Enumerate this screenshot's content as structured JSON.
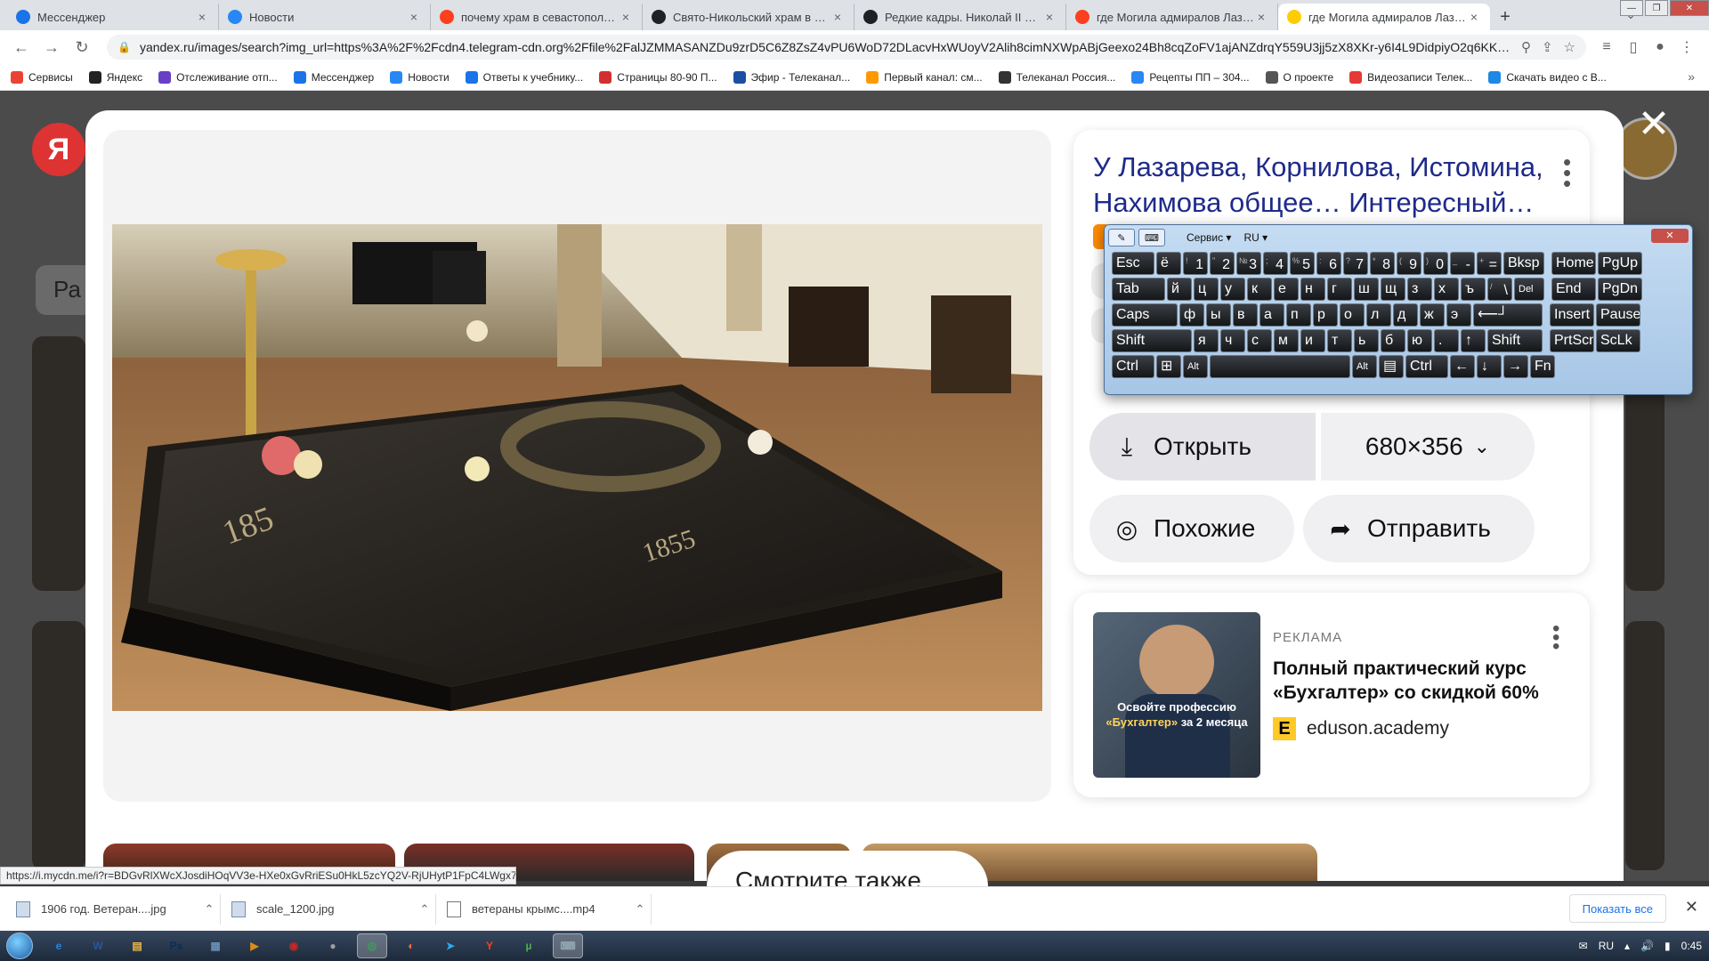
{
  "tabs": [
    {
      "title": "Мессенджер",
      "icon": "messenger-icon",
      "color": "#1a73e8",
      "active": false
    },
    {
      "title": "Новости",
      "icon": "vk-icon",
      "color": "#2787f5",
      "active": false
    },
    {
      "title": "почему храм в севастополе в ч",
      "icon": "yandex-icon",
      "color": "#fc3f1d",
      "active": false
    },
    {
      "title": "Свято-Никольский храм в Сева",
      "icon": "globe-icon",
      "color": "#202124",
      "active": false
    },
    {
      "title": "Редкие кадры. Николай II и Ром",
      "icon": "globe-icon",
      "color": "#202124",
      "active": false
    },
    {
      "title": "где Могила адмиралов Лазарев",
      "icon": "yandex-icon",
      "color": "#fc3f1d",
      "active": false
    },
    {
      "title": "где Могила адмиралов Лазарев",
      "icon": "yandex-images-icon",
      "color": "#ffcc00",
      "active": true
    }
  ],
  "address": {
    "url": "yandex.ru/images/search?img_url=https%3A%2F%2Fcdn4.telegram-cdn.org%2Ffile%2FalJZMMASANZDu9zrD5C6Z8ZsZ4vPU6WoD72DLacvHxWUoyV2Alih8cimNXWpABjGeexo24Bh8cqZoFV1ajANZdrqY559U3jj5zX8XKr-y6I4L9DidpiyO2q6KKUzYwST..."
  },
  "bookmarks": [
    {
      "label": "Сервисы",
      "color": "#ea4335"
    },
    {
      "label": "Яндекс",
      "color": "#222222"
    },
    {
      "label": "Отслеживание отп...",
      "color": "#6a3fc8"
    },
    {
      "label": "Мессенджер",
      "color": "#1a73e8"
    },
    {
      "label": "Новости",
      "color": "#2787f5"
    },
    {
      "label": "Ответы к учебнику...",
      "color": "#1a73e8"
    },
    {
      "label": "Страницы 80-90 П...",
      "color": "#d32f2f"
    },
    {
      "label": "Эфир - Телеканал...",
      "color": "#1a4fa3"
    },
    {
      "label": "Первый канал: см...",
      "color": "#ff9800"
    },
    {
      "label": "Телеканал Россия...",
      "color": "#333333"
    },
    {
      "label": "Рецепты ПП – 304...",
      "color": "#2787f5"
    },
    {
      "label": "О проекте",
      "color": "#555555"
    },
    {
      "label": "Видеозаписи Телек...",
      "color": "#e53935"
    },
    {
      "label": "Скачать видео с В...",
      "color": "#1e88e5"
    }
  ],
  "page_bg": {
    "chip_label": "Ра"
  },
  "viewer": {
    "title": "У Лазарева, Корнилова, Истомина, Нахимова общее… Интересный…",
    "open_label": "Открыть",
    "size_label": "680×356",
    "similar_label": "Похожие",
    "send_label": "Отправить",
    "tomb_year_left": "185",
    "tomb_year_right": "1855"
  },
  "ad": {
    "label": "РЕКЛАМА",
    "title": "Полный практический курс «Бухгалтер» со скидкой 60%",
    "domain": "eduson.academy",
    "image_caption_1": "Освойте профессию",
    "image_caption_2": "«Бухгалтер»",
    "image_caption_3": "за 2 месяца"
  },
  "see_also": "Смотрите также",
  "status_link": "https://i.mycdn.me/i?r=BDGvRlXWcXJosdiHOqVV3e-HXe0xGvRriESu0HkL5zcYQ2V-RjUHytP1FpC4LWgx7Mg",
  "osk": {
    "service": "Сервис",
    "lang": "RU",
    "rows": [
      [
        {
          "m": "Esc",
          "w": 48
        },
        {
          "m": "ё",
          "w": 28
        },
        {
          "m": "1",
          "s": "!",
          "w": 28
        },
        {
          "m": "2",
          "s": "\"",
          "w": 28
        },
        {
          "m": "3",
          "s": "№",
          "w": 28
        },
        {
          "m": "4",
          "s": ";",
          "w": 28
        },
        {
          "m": "5",
          "s": "%",
          "w": 28
        },
        {
          "m": "6",
          "s": ":",
          "w": 28
        },
        {
          "m": "7",
          "s": "?",
          "w": 28
        },
        {
          "m": "8",
          "s": "*",
          "w": 28
        },
        {
          "m": "9",
          "s": "(",
          "w": 28
        },
        {
          "m": "0",
          "s": ")",
          "w": 28
        },
        {
          "m": "-",
          "s": "_",
          "w": 28
        },
        {
          "m": "=",
          "s": "+",
          "w": 28
        },
        {
          "m": "Bksp",
          "w": 46
        },
        {
          "m": "Home",
          "w": 50,
          "gap": 6
        },
        {
          "m": "PgUp",
          "w": 50
        }
      ],
      [
        {
          "m": "Tab",
          "w": 60
        },
        {
          "m": "й",
          "w": 28
        },
        {
          "m": "ц",
          "w": 28
        },
        {
          "m": "у",
          "w": 28
        },
        {
          "m": "к",
          "w": 28
        },
        {
          "m": "е",
          "w": 28
        },
        {
          "m": "н",
          "w": 28
        },
        {
          "m": "г",
          "w": 28
        },
        {
          "m": "ш",
          "w": 28
        },
        {
          "m": "щ",
          "w": 28
        },
        {
          "m": "з",
          "w": 28
        },
        {
          "m": "х",
          "w": 28
        },
        {
          "m": "ъ",
          "w": 28
        },
        {
          "m": "\\",
          "s": "/",
          "w": 28
        },
        {
          "m": "Del",
          "w": 34,
          "small": true
        },
        {
          "m": "End",
          "w": 50,
          "gap": 6
        },
        {
          "m": "PgDn",
          "w": 50
        }
      ],
      [
        {
          "m": "Caps",
          "w": 74
        },
        {
          "m": "ф",
          "w": 28
        },
        {
          "m": "ы",
          "w": 28
        },
        {
          "m": "в",
          "w": 28
        },
        {
          "m": "а",
          "w": 28
        },
        {
          "m": "п",
          "w": 28
        },
        {
          "m": "р",
          "w": 28
        },
        {
          "m": "о",
          "w": 28
        },
        {
          "m": "л",
          "w": 28
        },
        {
          "m": "д",
          "w": 28
        },
        {
          "m": "ж",
          "w": 28
        },
        {
          "m": "э",
          "w": 28
        },
        {
          "m": "⟵┘",
          "w": 78
        },
        {
          "m": "Insert",
          "w": 50,
          "gap": 6
        },
        {
          "m": "Pause",
          "w": 50
        }
      ],
      [
        {
          "m": "Shift",
          "w": 90
        },
        {
          "m": "я",
          "w": 28
        },
        {
          "m": "ч",
          "w": 28
        },
        {
          "m": "с",
          "w": 28
        },
        {
          "m": "м",
          "w": 28
        },
        {
          "m": "и",
          "w": 28
        },
        {
          "m": "т",
          "w": 28
        },
        {
          "m": "ь",
          "w": 28
        },
        {
          "m": "б",
          "w": 28
        },
        {
          "m": "ю",
          "w": 28
        },
        {
          "m": ".",
          "w": 28
        },
        {
          "m": "↑",
          "w": 28
        },
        {
          "m": "Shift",
          "w": 62
        },
        {
          "m": "PrtScn",
          "w": 50,
          "gap": 6
        },
        {
          "m": "ScLk",
          "w": 50
        }
      ],
      [
        {
          "m": "Ctrl",
          "w": 48
        },
        {
          "m": "⊞",
          "w": 28
        },
        {
          "m": "Alt",
          "w": 28,
          "small": true
        },
        {
          "m": "",
          "w": 158
        },
        {
          "m": "Alt",
          "w": 28,
          "small": true
        },
        {
          "m": "▤",
          "w": 28
        },
        {
          "m": "Ctrl",
          "w": 48
        },
        {
          "m": "←",
          "w": 28
        },
        {
          "m": "↓",
          "w": 28
        },
        {
          "m": "→",
          "w": 28
        },
        {
          "m": "Fn",
          "w": 28
        }
      ]
    ]
  },
  "downloads": [
    {
      "name": "1906 год. Ветеран....jpg",
      "type": "image"
    },
    {
      "name": "scale_1200.jpg",
      "type": "image"
    },
    {
      "name": "ветераны крымс....mp4",
      "type": "video"
    }
  ],
  "show_all": "Показать все",
  "taskbar": {
    "apps": [
      {
        "name": "ie-icon",
        "glyph": "e",
        "color": "#1e88e5"
      },
      {
        "name": "word-icon",
        "glyph": "W",
        "color": "#2b579a"
      },
      {
        "name": "explorer-icon",
        "glyph": "▤",
        "color": "#e8b84a"
      },
      {
        "name": "photoshop-icon",
        "glyph": "Ps",
        "color": "#0a2d5a"
      },
      {
        "name": "notepad-icon",
        "glyph": "▦",
        "color": "#6b8fb5"
      },
      {
        "name": "media-player-icon",
        "glyph": "▶",
        "color": "#d98b1b"
      },
      {
        "name": "recorder-icon",
        "glyph": "◉",
        "color": "#c62828"
      },
      {
        "name": "disc-icon",
        "glyph": "●",
        "color": "#9e9e9e"
      },
      {
        "name": "chrome-icon",
        "glyph": "◎",
        "color": "#34a853",
        "active": true
      },
      {
        "name": "firefox-icon",
        "glyph": "◐",
        "color": "#ff7139"
      },
      {
        "name": "telegram-icon",
        "glyph": "➤",
        "color": "#2aabee"
      },
      {
        "name": "yandex-browser-icon",
        "glyph": "Y",
        "color": "#fc3f1d"
      },
      {
        "name": "utorrent-icon",
        "glyph": "µ",
        "color": "#4caf50"
      },
      {
        "name": "osk-icon",
        "glyph": "⌨",
        "color": "#90a4ae",
        "active": true
      }
    ],
    "lang": "RU",
    "time": "0:45"
  }
}
